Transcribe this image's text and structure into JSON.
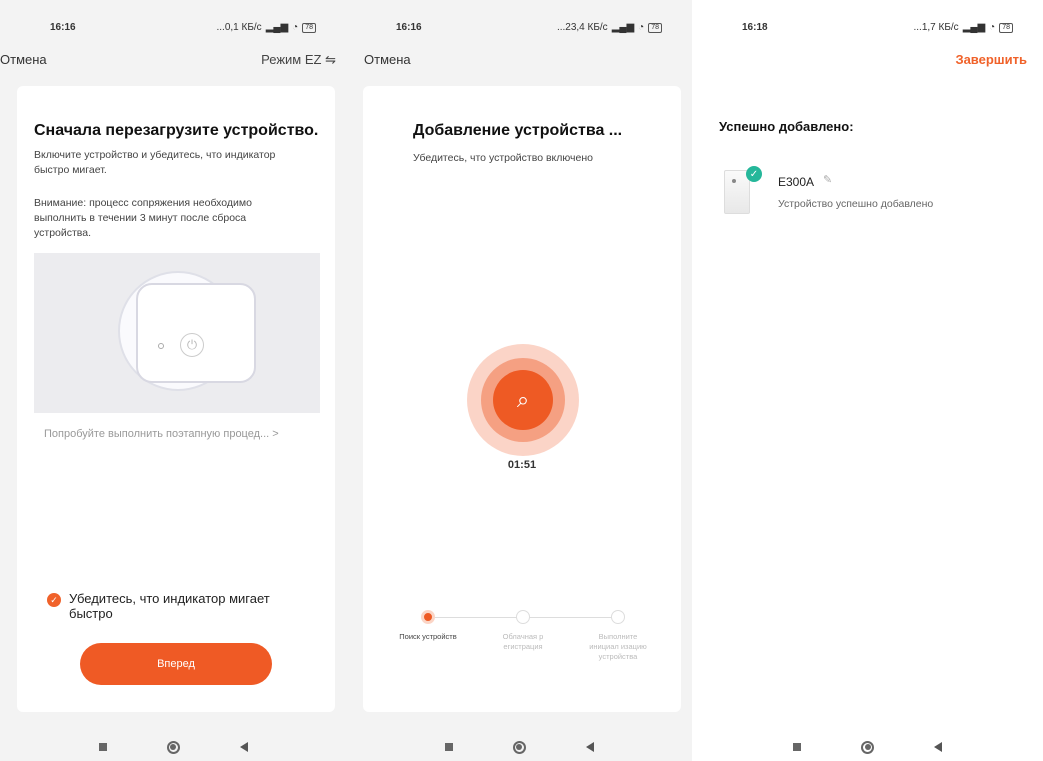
{
  "screens": [
    {
      "status": {
        "time": "16:16",
        "speed": "...0,1 КБ/с",
        "battery": "78"
      },
      "topbar": {
        "cancel": "Отмена",
        "mode": "Режим EZ",
        "mode_icon": "swap-arrows-icon"
      },
      "title": "Сначала перезагрузите устройство.",
      "text1": "Включите устройство и убедитесь, что индикатор быстро мигает.",
      "text2": "Внимание: процесс сопряжения необходимо выполнить в течении 3 минут после сброса устройства.",
      "step_link": "Попробуйте выполнить поэтапную процед... >",
      "confirm_check": "Убедитесь, что индикатор мигает быстро",
      "next_button": "Вперед"
    },
    {
      "status": {
        "time": "16:16",
        "speed": "...23,4 КБ/с",
        "battery": "78"
      },
      "topbar": {
        "cancel": "Отмена"
      },
      "title": "Добавление устройства ...",
      "text1": "Убедитесь, что устройство включено",
      "timer": "01:51",
      "steps": [
        {
          "label": "Поиск устройств",
          "active": true
        },
        {
          "label": "Облачная р егистрация",
          "active": false
        },
        {
          "label": "Выполните инициал изацию устройства",
          "active": false
        }
      ]
    },
    {
      "status": {
        "time": "16:18",
        "speed": "...1,7 КБ/с",
        "battery": "78"
      },
      "topbar": {
        "finish": "Завершить"
      },
      "title": "Успешно добавлено:",
      "device": {
        "name": "E300A",
        "status": "Устройство успешно добавлено"
      }
    }
  ],
  "colors": {
    "accent": "#ef5a25",
    "success": "#25b79a",
    "background": "#f3f3f3"
  }
}
